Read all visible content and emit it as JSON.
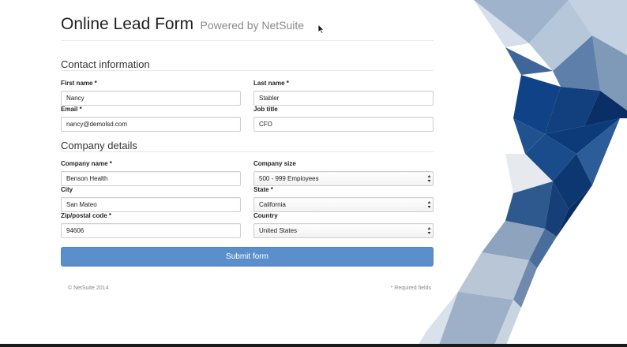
{
  "header": {
    "title": "Online Lead Form",
    "subtitle": "Powered by NetSuite"
  },
  "sections": {
    "contact": {
      "title": "Contact information",
      "first_name": {
        "label": "First name *",
        "value": "Nancy"
      },
      "last_name": {
        "label": "Last name *",
        "value": "Stabler"
      },
      "email": {
        "label": "Email *",
        "value": "nancy@demolsd.com"
      },
      "job_title": {
        "label": "Job title",
        "value": "CFO"
      }
    },
    "company": {
      "title": "Company details",
      "company_name": {
        "label": "Company name *",
        "value": "Benson Health"
      },
      "company_size": {
        "label": "Company size",
        "value": "500 - 999 Employees"
      },
      "city": {
        "label": "City",
        "value": "San Mateo"
      },
      "state": {
        "label": "State *",
        "value": "California"
      },
      "zip": {
        "label": "Zip/postal code *",
        "value": "94606"
      },
      "country": {
        "label": "Country",
        "value": "United States"
      }
    }
  },
  "submit_label": "Submit form",
  "footer": {
    "copyright": "© NetSuite 2014",
    "required_note": "* Required fields"
  },
  "colors": {
    "accent": "#5b8fcb",
    "navy": "#0d3a78",
    "steel": "#8fa6c2"
  },
  "icons": {
    "cursor": "arrow-cursor-icon",
    "select_arrows": "select-arrows-icon"
  }
}
